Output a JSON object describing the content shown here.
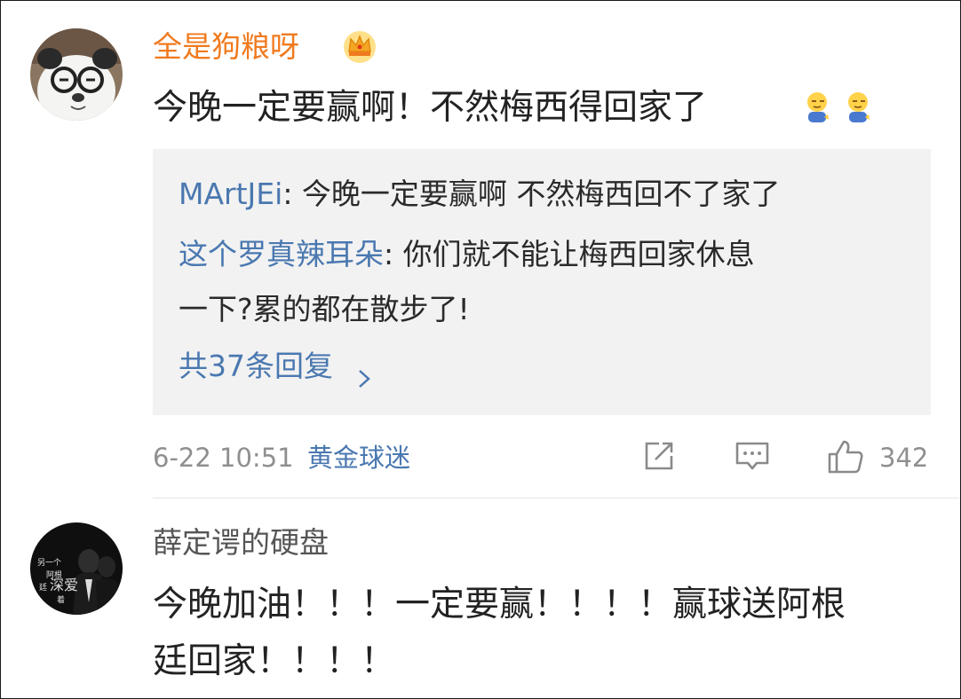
{
  "colors": {
    "accent_orange": "#f07a1e",
    "link_blue": "#4a78b0",
    "meta_gray": "#8f8f8f",
    "reply_bg": "#f2f2f2"
  },
  "comments": [
    {
      "username": "全是狗粮呀",
      "badge_icon": "crown-badge-icon",
      "text": "今晚一定要赢啊！不然梅西得回家了",
      "emoji_icons": [
        "sleepy-face-emoji-icon",
        "sleepy-face-emoji-icon"
      ],
      "replies": [
        {
          "author": "MArtJEi",
          "sep": ": ",
          "text": "今晚一定要赢啊 不然梅西回不了家了"
        },
        {
          "author": "这个罗真辣耳朵",
          "sep": ": ",
          "text": "你们就不能让梅西回家休息",
          "text_cont": "一下?累的都在散步了!"
        }
      ],
      "more_replies": "共37条回复",
      "more_icon": "chevron-right-icon",
      "time": "6-22 10:51",
      "fan_label": "黄金球迷",
      "repost_icon": "repost-icon",
      "comment_icon": "comment-icon",
      "like_icon": "thumbs-up-icon",
      "like_count": "342"
    },
    {
      "username": "薛定谔的硬盘",
      "text_line1": "今晚加油！！！一定要赢！！！！赢球送阿根",
      "text_line2": "廷回家！！！！"
    }
  ]
}
